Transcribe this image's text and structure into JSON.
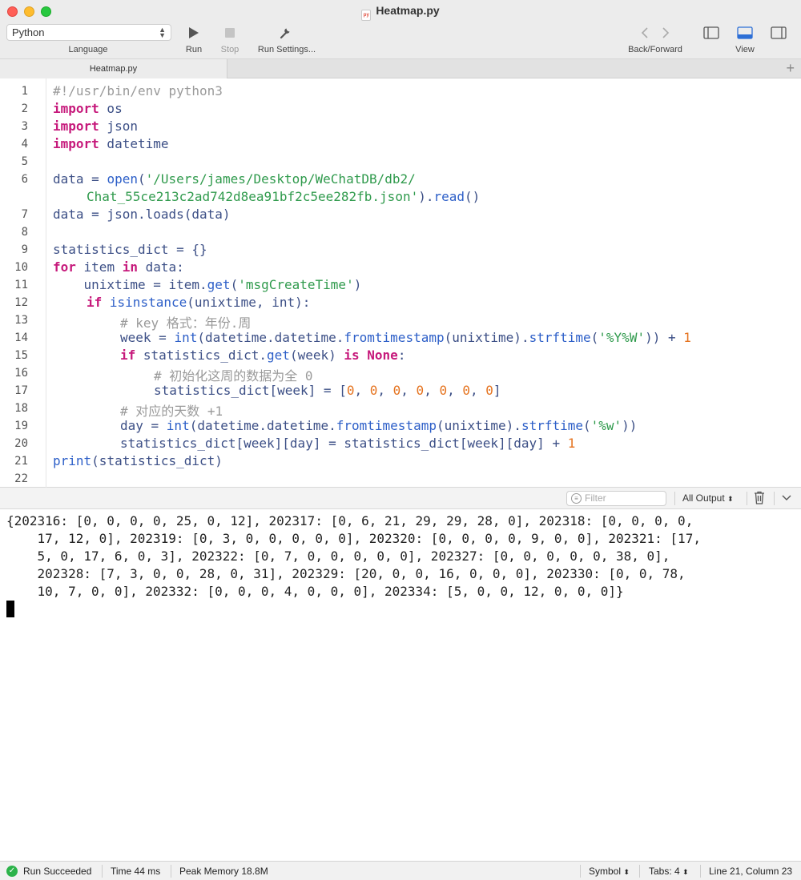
{
  "window": {
    "title": "Heatmap.py",
    "file_badge": "py"
  },
  "toolbar": {
    "language_value": "Python",
    "language_label": "Language",
    "run_label": "Run",
    "stop_label": "Stop",
    "run_settings_label": "Run Settings...",
    "back_forward_label": "Back/Forward",
    "view_label": "View"
  },
  "tabs": [
    {
      "label": "Heatmap.py",
      "active": true
    }
  ],
  "editor": {
    "line_numbers": [
      "1",
      "2",
      "3",
      "4",
      "5",
      "6",
      "7",
      "8",
      "9",
      "10",
      "11",
      "12",
      "13",
      "14",
      "15",
      "16",
      "17",
      "18",
      "19",
      "20",
      "21",
      "22"
    ],
    "lines": {
      "l1": "#!/usr/bin/env python3",
      "l2_kw": "import",
      "l2_rest": " os",
      "l3_kw": "import",
      "l3_rest": " json",
      "l4_kw": "import",
      "l4_rest": " datetime",
      "l6a_var": "data",
      "l6a_eq": " = ",
      "l6a_fn": "open",
      "l6a_paren": "(",
      "l6a_str": "'/Users/james/Desktop/WeChatDB/db2/",
      "l6b_str": "Chat_55ce213c2ad742d8ea91bf2c5ee282fb.json'",
      "l6b_close": ")",
      "l6b_dot": ".",
      "l6b_fn": "read",
      "l6b_end": "()",
      "l7": "data = json.loads(data)",
      "l9": "statistics_dict = {}",
      "l10_kw1": "for",
      "l10_mid": " item ",
      "l10_kw2": "in",
      "l10_rest": " data:",
      "l11_pre": "    unixtime = item.",
      "l11_fn": "get",
      "l11_open": "(",
      "l11_str": "'msgCreateTime'",
      "l11_close": ")",
      "l12_kw": "if",
      "l12_fn": "isinstance",
      "l12_rest": "(unixtime, int):",
      "l13": "# key 格式：年份.周",
      "l14_pre": "week = ",
      "l14_fn1": "int",
      "l14_a": "(datetime.datetime.",
      "l14_fn2": "fromtimestamp",
      "l14_b": "(unixtime).",
      "l14_fn3": "strftime",
      "l14_c": "(",
      "l14_str": "'%Y%W'",
      "l14_d": ")) + ",
      "l14_num": "1",
      "l15_kw1": "if",
      "l15_mid": " statistics_dict.",
      "l15_fn": "get",
      "l15_rest": "(week) ",
      "l15_kw2": "is",
      "l15_sp": " ",
      "l15_kw3": "None",
      "l15_end": ":",
      "l16": "# 初始化这周的数据为全 0",
      "l17_pre": "statistics_dict[week] = [",
      "l17_n": "0",
      "l17_sep": ", ",
      "l17_end": "]",
      "l18": "# 对应的天数 +1",
      "l19_pre": "day = ",
      "l19_fn1": "int",
      "l19_a": "(datetime.datetime.",
      "l19_fn2": "fromtimestamp",
      "l19_b": "(unixtime).",
      "l19_fn3": "strftime",
      "l19_c": "(",
      "l19_str": "'%w'",
      "l19_d": "))",
      "l20_pre": "statistics_dict[week][day] = statistics_dict[week][day] + ",
      "l20_num": "1",
      "l21_fn": "print",
      "l21_rest": "(statistics_dict)"
    }
  },
  "console_toolbar": {
    "filter_placeholder": "Filter",
    "output_filter": "All Output"
  },
  "console": {
    "output_lines": [
      "{202316: [0, 0, 0, 0, 25, 0, 12], 202317: [0, 6, 21, 29, 29, 28, 0], 202318: [0, 0, 0, 0,",
      "    17, 12, 0], 202319: [0, 3, 0, 0, 0, 0, 0], 202320: [0, 0, 0, 0, 9, 0, 0], 202321: [17,",
      "    5, 0, 17, 6, 0, 3], 202322: [0, 7, 0, 0, 0, 0, 0], 202327: [0, 0, 0, 0, 0, 38, 0],",
      "    202328: [7, 3, 0, 0, 28, 0, 31], 202329: [20, 0, 0, 16, 0, 0, 0], 202330: [0, 0, 78,",
      "    10, 7, 0, 0], 202332: [0, 0, 0, 4, 0, 0, 0], 202334: [5, 0, 0, 12, 0, 0, 0]}"
    ]
  },
  "statusbar": {
    "run_status": "Run Succeeded",
    "time": "Time 44 ms",
    "memory": "Peak Memory 18.8M",
    "symbol": "Symbol",
    "tabs": "Tabs: 4",
    "position": "Line 21, Column 23"
  },
  "colors": {
    "keyword": "#c6197b",
    "comment": "#9a9a9a",
    "string": "#2f9a4c",
    "number": "#e5731f",
    "function": "#2d5fc8",
    "identifier": "#3c4f86",
    "success": "#2cb34a"
  }
}
